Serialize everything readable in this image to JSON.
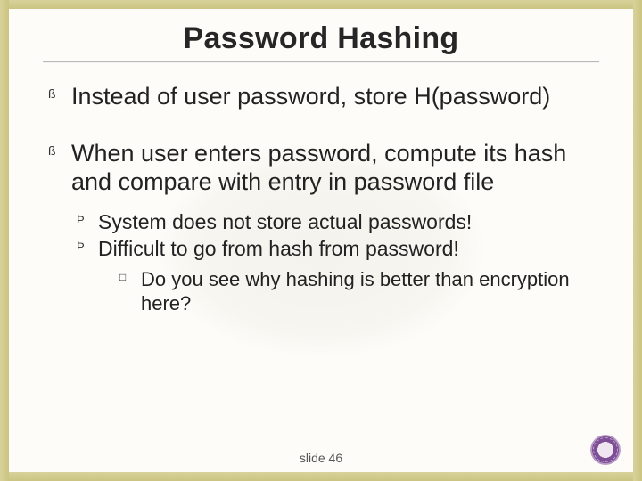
{
  "title": "Password Hashing",
  "bullets": [
    {
      "text": "Instead of user password, store H(password)"
    },
    {
      "text": "When user enters password, compute its hash and compare with entry in password file",
      "sub": [
        {
          "text": "System does not store actual passwords!"
        },
        {
          "text": "Difficult to go from hash from password!",
          "sub": [
            {
              "text": "Do you see why hashing is better than encryption here?"
            }
          ]
        }
      ]
    }
  ],
  "footer": "slide 46"
}
